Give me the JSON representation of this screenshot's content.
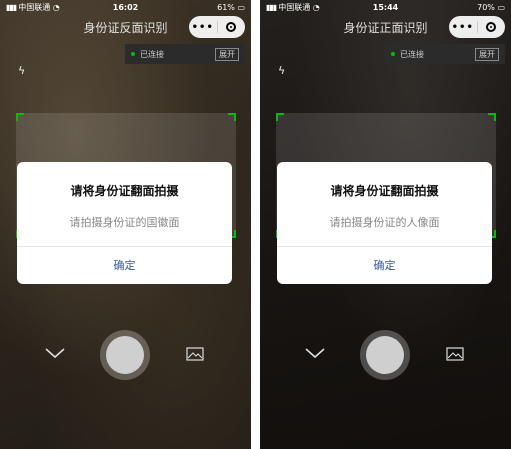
{
  "screens": [
    {
      "status_bar": {
        "carrier": "中国联通",
        "time": "16:02",
        "battery": "61%"
      },
      "nav_title": "身份证反面识别",
      "capsule": {
        "more": "•••"
      },
      "connection": {
        "status": "已连接",
        "expand": "展开"
      },
      "dialog": {
        "title": "请将身份证翻面拍摄",
        "message": "请拍摄身份证的国徽面",
        "confirm": "确定"
      }
    },
    {
      "status_bar": {
        "carrier": "中国联通",
        "time": "15:44",
        "battery": "70%"
      },
      "nav_title": "身份证正面识别",
      "capsule": {
        "more": "•••"
      },
      "connection": {
        "status": "已连接",
        "expand": "展开"
      },
      "dialog": {
        "title": "请将身份证翻面拍摄",
        "message": "请拍摄身份证的人像面",
        "confirm": "确定"
      }
    }
  ],
  "colors": {
    "accent_green": "#09bb07",
    "dialog_button": "#3b5998"
  },
  "icons": [
    "flash-icon",
    "chevron-down-icon",
    "shutter-button",
    "gallery-icon",
    "wifi-icon",
    "close-icon"
  ]
}
